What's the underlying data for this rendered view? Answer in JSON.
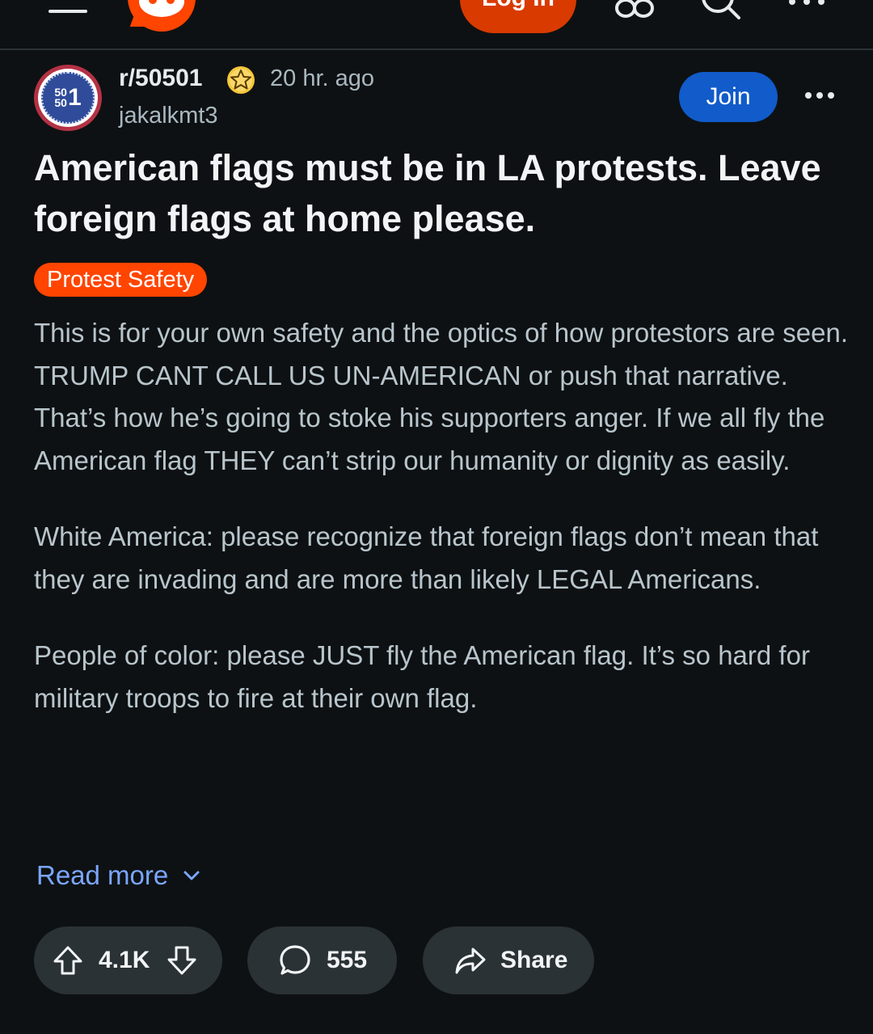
{
  "topbar": {
    "login_label": "Log In"
  },
  "post": {
    "subreddit": "r/50501",
    "avatar_text_small_top": "50",
    "avatar_text_small_bottom": "50",
    "avatar_text_big": "1",
    "time": "20 hr. ago",
    "author": "jakalkmt3",
    "join_label": "Join",
    "title": "American flags must be in LA protests. Leave foreign flags at home please.",
    "flair": "Protest Safety",
    "flair_color": "#ff4500",
    "paragraphs": [
      "This is for your own safety and the optics of how protestors are seen. TRUMP CANT CALL US UN-AMERICAN or push that narrative. That’s how he’s going to stoke his supporters anger. If we all fly the American flag THEY can’t strip our humanity or dignity as easily.",
      "White America: please recognize that foreign flags don’t mean that they are invading and are more than likely LEGAL Americans.",
      "People of color: please JUST fly the American flag. It’s so hard for military troops to fire at their own flag."
    ],
    "read_more": "Read more"
  },
  "actions": {
    "votes": "4.1K",
    "comments": "555",
    "share_label": "Share"
  },
  "colors": {
    "background": "#0e1113",
    "accent_orange": "#ff4500",
    "join_blue": "#115bca",
    "link_blue": "#7aa6ff",
    "pill_gray": "#2a3236"
  },
  "icons": [
    "menu-icon",
    "reddit-logo-icon",
    "chat-icon",
    "search-icon",
    "more-icon",
    "star-badge-icon",
    "upvote-icon",
    "downvote-icon",
    "comment-icon",
    "share-icon",
    "chevron-down-icon"
  ]
}
